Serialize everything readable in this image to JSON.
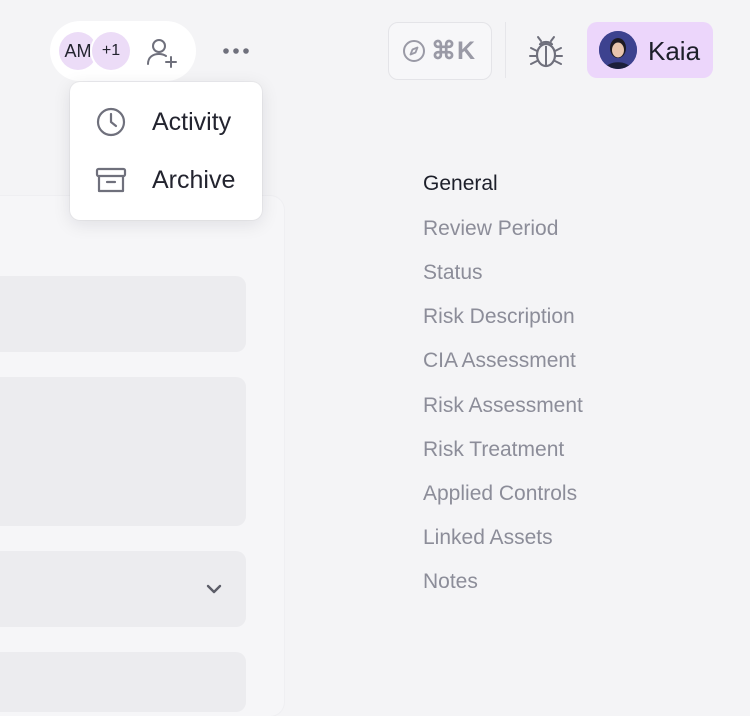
{
  "header": {
    "presence": {
      "avatars": [
        {
          "initials": "AM"
        },
        {
          "initials": "+1"
        }
      ],
      "add_user_icon": "user-plus-icon"
    },
    "more_icon": "more-horizontal-icon",
    "command": {
      "shortcut": "⌘K",
      "icon": "compass-icon"
    },
    "bug_icon": "bug-icon",
    "user": {
      "name": "Kaia"
    }
  },
  "more_menu": {
    "items": [
      {
        "label": "Activity",
        "icon": "clock-icon"
      },
      {
        "label": "Archive",
        "icon": "archive-icon"
      }
    ]
  },
  "toc": {
    "active": "General",
    "items": [
      {
        "label": "General"
      },
      {
        "label": "Review Period"
      },
      {
        "label": "Status"
      },
      {
        "label": "Risk Description"
      },
      {
        "label": "CIA Assessment"
      },
      {
        "label": "Risk Assessment"
      },
      {
        "label": "Risk Treatment"
      },
      {
        "label": "Applied Controls"
      },
      {
        "label": "Linked Assets"
      },
      {
        "label": "Notes"
      }
    ]
  },
  "colors": {
    "background": "#f4f4f6",
    "accent_user": "#ecd6fb",
    "avatar_chip": "#ecdcf7",
    "text_primary": "#1d1f2a",
    "text_muted": "#8c8d99"
  }
}
